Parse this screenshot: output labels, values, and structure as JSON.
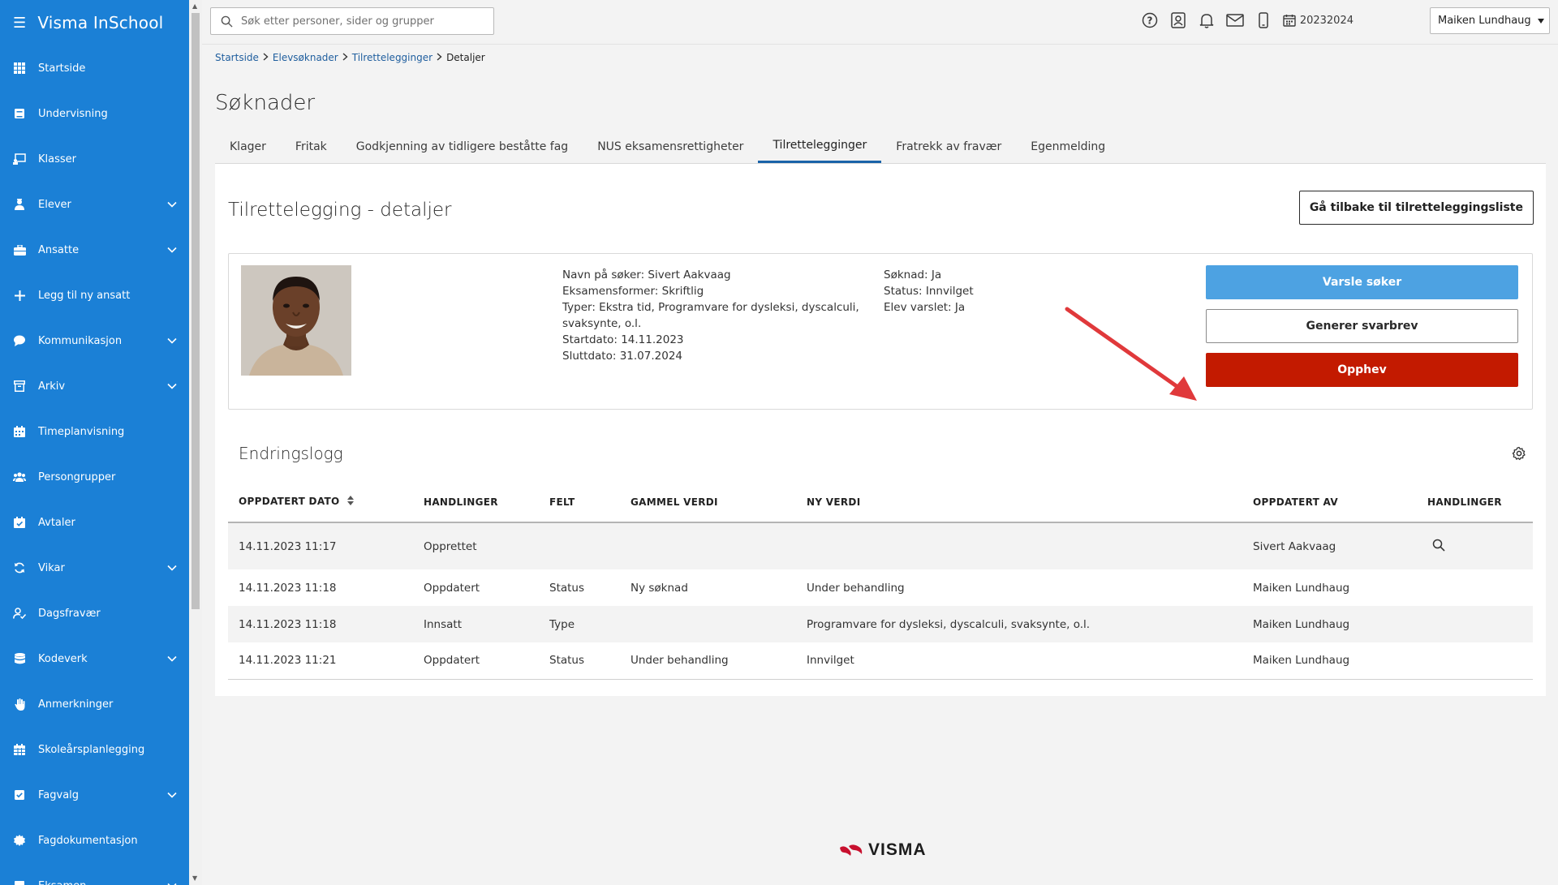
{
  "app": {
    "title": "Visma InSchool"
  },
  "sidebar": {
    "items": [
      {
        "label": "Startside",
        "icon": "grid-icon",
        "expandable": false
      },
      {
        "label": "Undervisning",
        "icon": "book-icon",
        "expandable": false
      },
      {
        "label": "Klasser",
        "icon": "board-icon",
        "expandable": false
      },
      {
        "label": "Elever",
        "icon": "student-icon",
        "expandable": true
      },
      {
        "label": "Ansatte",
        "icon": "briefcase-icon",
        "expandable": true
      },
      {
        "label": "Legg til ny ansatt",
        "icon": "plus-icon",
        "expandable": false
      },
      {
        "label": "Kommunikasjon",
        "icon": "chat-icon",
        "expandable": true
      },
      {
        "label": "Arkiv",
        "icon": "archive-icon",
        "expandable": true
      },
      {
        "label": "Timeplanvisning",
        "icon": "calendar-icon",
        "expandable": false
      },
      {
        "label": "Persongrupper",
        "icon": "group-icon",
        "expandable": false
      },
      {
        "label": "Avtaler",
        "icon": "calendar-check-icon",
        "expandable": false
      },
      {
        "label": "Vikar",
        "icon": "refresh-icon",
        "expandable": true
      },
      {
        "label": "Dagsfravær",
        "icon": "user-check-icon",
        "expandable": false
      },
      {
        "label": "Kodeverk",
        "icon": "database-icon",
        "expandable": true
      },
      {
        "label": "Anmerkninger",
        "icon": "hand-icon",
        "expandable": false
      },
      {
        "label": "Skoleårsplanlegging",
        "icon": "calendar-grid-icon",
        "expandable": false
      },
      {
        "label": "Fagvalg",
        "icon": "book-check-icon",
        "expandable": true
      },
      {
        "label": "Fagdokumentasjon",
        "icon": "gear-badge-icon",
        "expandable": false
      },
      {
        "label": "Eksamen",
        "icon": "exam-icon",
        "expandable": true
      }
    ]
  },
  "topbar": {
    "search_placeholder": "Søk etter personer, sider og grupper",
    "school_year": "20232024",
    "user_name": "Maiken Lundhaug"
  },
  "breadcrumb": {
    "items": [
      "Startside",
      "Elevsøknader",
      "Tilrettelegginger"
    ],
    "current": "Detaljer"
  },
  "page": {
    "title": "Søknader"
  },
  "tabs": [
    {
      "label": "Klager",
      "active": false
    },
    {
      "label": "Fritak",
      "active": false
    },
    {
      "label": "Godkjenning av tidligere beståtte fag",
      "active": false
    },
    {
      "label": "NUS eksamensrettigheter",
      "active": false
    },
    {
      "label": "Tilrettelegginger",
      "active": true
    },
    {
      "label": "Fratrekk av fravær",
      "active": false
    },
    {
      "label": "Egenmelding",
      "active": false
    }
  ],
  "detail": {
    "title": "Tilrettelegging - detaljer",
    "back_label": "Gå tilbake til tilretteleggingsliste",
    "info_left": [
      "Navn på søker: Sivert Aakvaag",
      "Eksamensformer: Skriftlig",
      "Typer: Ekstra tid, Programvare for dysleksi, dyscalculi, svaksynte, o.l.",
      "Startdato: 14.11.2023",
      "Sluttdato: 31.07.2024"
    ],
    "info_right": [
      "Søknad: Ja",
      "Status: Innvilget",
      "Elev varslet: Ja"
    ],
    "buttons": {
      "notify": "Varsle søker",
      "letter": "Generer svarbrev",
      "revoke": "Opphev"
    },
    "colors": {
      "notify": "#4da2e2",
      "revoke": "#c31a00",
      "arrow": "#e0393b"
    }
  },
  "changelog": {
    "title": "Endringslogg",
    "columns": [
      "OPPDATERT DATO",
      "HANDLINGER",
      "FELT",
      "GAMMEL VERDI",
      "NY VERDI",
      "OPPDATERT AV",
      "HANDLINGER"
    ],
    "rows": [
      {
        "date": "14.11.2023 11:17",
        "action": "Opprettet",
        "field": "",
        "old": "",
        "new": "",
        "by": "Sivert Aakvaag",
        "has_view": true
      },
      {
        "date": "14.11.2023 11:18",
        "action": "Oppdatert",
        "field": "Status",
        "old": "Ny søknad",
        "new": "Under behandling",
        "by": "Maiken Lundhaug",
        "has_view": false
      },
      {
        "date": "14.11.2023 11:18",
        "action": "Innsatt",
        "field": "Type",
        "old": "",
        "new": "Programvare for dysleksi, dyscalculi, svaksynte, o.l.",
        "by": "Maiken Lundhaug",
        "has_view": false
      },
      {
        "date": "14.11.2023 11:21",
        "action": "Oppdatert",
        "field": "Status",
        "old": "Under behandling",
        "new": "Innvilget",
        "by": "Maiken Lundhaug",
        "has_view": false
      }
    ]
  },
  "footer": {
    "logo_text": "VISMA"
  },
  "brand_color": "#1b80d6"
}
